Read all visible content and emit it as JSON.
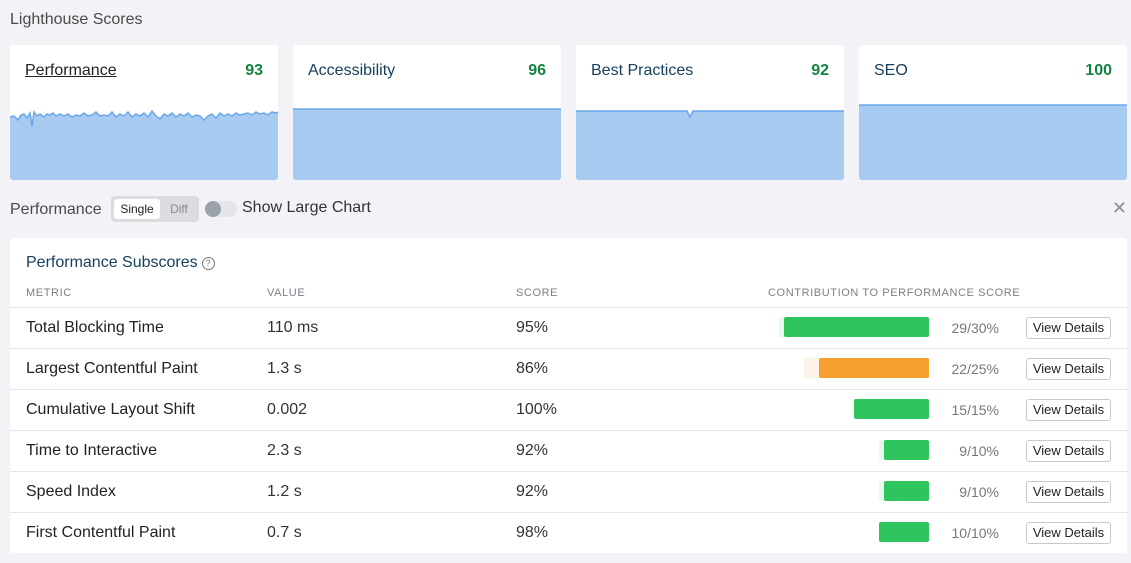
{
  "header": {
    "title": "Lighthouse Scores"
  },
  "cards": [
    {
      "label": "Performance",
      "score": "93",
      "link": true
    },
    {
      "label": "Accessibility",
      "score": "96",
      "link": false
    },
    {
      "label": "Best Practices",
      "score": "92",
      "link": false
    },
    {
      "label": "SEO",
      "score": "100",
      "link": false
    }
  ],
  "colors": {
    "score_green": "#13843f",
    "chart_fill": "#a6caf0",
    "chart_line": "#6aa8e8",
    "bar_green": "#2fc55e",
    "bar_orange": "#f5a02f"
  },
  "perf_controls": {
    "label": "Performance",
    "mode_single": "Single",
    "mode_diff": "Diff",
    "selected_mode": "Single",
    "toggle_label": "Show Large Chart",
    "toggle_on": false,
    "close_symbol": "✕"
  },
  "subscores": {
    "title": "Performance Subscores",
    "help_symbol": "?",
    "columns": {
      "metric": "METRIC",
      "value": "VALUE",
      "score": "SCORE",
      "contribution": "CONTRIBUTION TO PERFORMANCE SCORE"
    },
    "button_label": "View Details",
    "rows": [
      {
        "metric": "Total Blocking Time",
        "value": "110 ms",
        "score": "95%",
        "contribution": "29/30%",
        "earned": 29,
        "max": 30,
        "color": "green"
      },
      {
        "metric": "Largest Contentful Paint",
        "value": "1.3 s",
        "score": "86%",
        "contribution": "22/25%",
        "earned": 22,
        "max": 25,
        "color": "orange"
      },
      {
        "metric": "Cumulative Layout Shift",
        "value": "0.002",
        "score": "100%",
        "contribution": "15/15%",
        "earned": 15,
        "max": 15,
        "color": "green"
      },
      {
        "metric": "Time to Interactive",
        "value": "2.3 s",
        "score": "92%",
        "contribution": "9/10%",
        "earned": 9,
        "max": 10,
        "color": "green"
      },
      {
        "metric": "Speed Index",
        "value": "1.2 s",
        "score": "92%",
        "contribution": "9/10%",
        "earned": 9,
        "max": 10,
        "color": "green"
      },
      {
        "metric": "First Contentful Paint",
        "value": "0.7 s",
        "score": "98%",
        "contribution": "10/10%",
        "earned": 10,
        "max": 10,
        "color": "green"
      }
    ]
  }
}
